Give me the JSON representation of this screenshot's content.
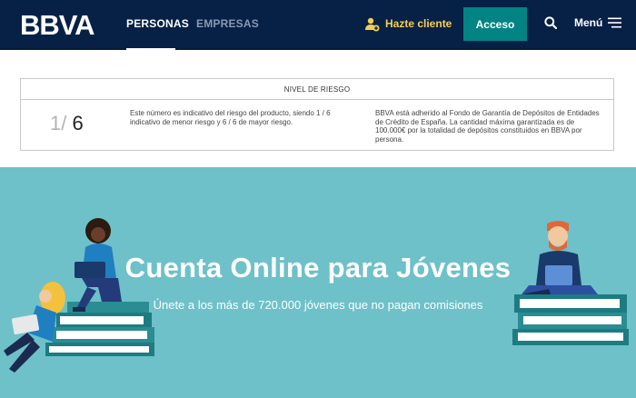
{
  "header": {
    "logo_text": "BBVA",
    "nav": {
      "personas": "PERSONAS",
      "empresas": "EMPRESAS"
    },
    "hazte_cliente": "Hazte cliente",
    "acceso": "Acceso",
    "menu": "Menú",
    "icons": {
      "user_add": "user-add-icon",
      "search": "search-icon",
      "menu": "hamburger-menu-icon"
    },
    "colors": {
      "background": "#072146",
      "accent": "#f8cd51",
      "button": "#028484"
    }
  },
  "risk": {
    "heading": "NIVEL DE RIESGO",
    "level": "1",
    "separator": "/",
    "max": "6",
    "description": "Este número es indicativo del riesgo del producto, siendo 1 / 6 indicativo de menor riesgo y 6 / 6 de mayor riesgo.",
    "fgd_text": "BBVA está adherido al Fondo de Garantía de Depósitos de Entidades de Crédito de España. La cantidad máxima garantizada es de 100.000€ por la totalidad de depósitos constituidos en BBVA por persona."
  },
  "hero": {
    "title": "Cuenta Online para Jóvenes",
    "subtitle": "Únete a los más de 720.000 jóvenes que no pagan comisiones",
    "background_color": "#6ec1c9"
  }
}
